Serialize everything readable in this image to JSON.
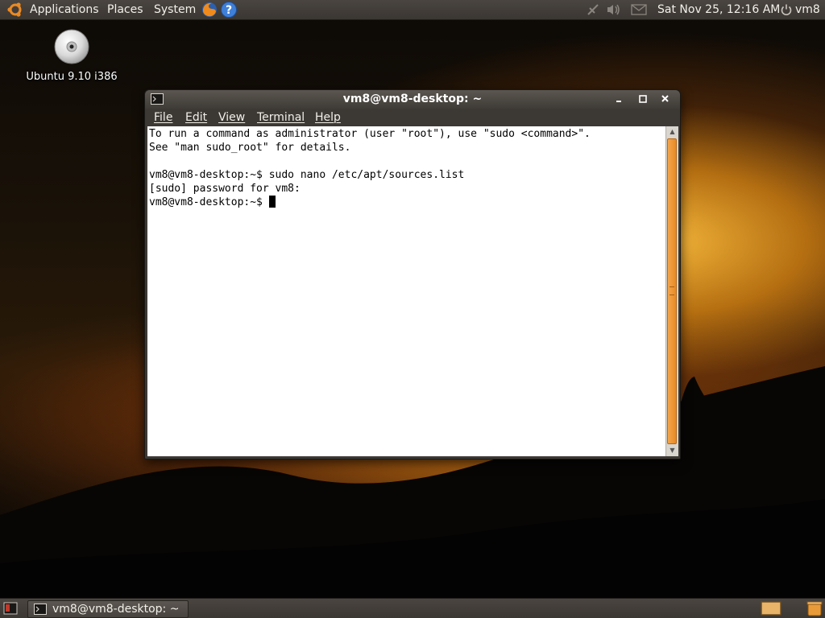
{
  "top_panel": {
    "menus": [
      "Applications",
      "Places",
      "System"
    ],
    "clock": "Sat Nov 25, 12:16 AM",
    "user": "vm8",
    "icons": [
      "ubuntu-logo-icon",
      "firefox-icon",
      "help-icon",
      "network-icon",
      "volume-icon",
      "mail-icon",
      "power-icon"
    ]
  },
  "desktop": {
    "icons": [
      {
        "label": "Ubuntu 9.10 i386",
        "icon": "cd-icon"
      }
    ]
  },
  "terminal": {
    "title": "vm8@vm8-desktop: ~",
    "menu": [
      "File",
      "Edit",
      "View",
      "Terminal",
      "Help"
    ],
    "lines": [
      "To run a command as administrator (user \"root\"), use \"sudo <command>\".",
      "See \"man sudo_root\" for details.",
      "",
      "vm8@vm8-desktop:~$ sudo nano /etc/apt/sources.list",
      "[sudo] password for vm8:",
      "vm8@vm8-desktop:~$ "
    ]
  },
  "bottom_panel": {
    "task": "vm8@vm8-desktop: ~"
  },
  "colors": {
    "panel": "#3f3b36",
    "accent": "#e98a24",
    "terminal_bg": "#ffffff"
  }
}
